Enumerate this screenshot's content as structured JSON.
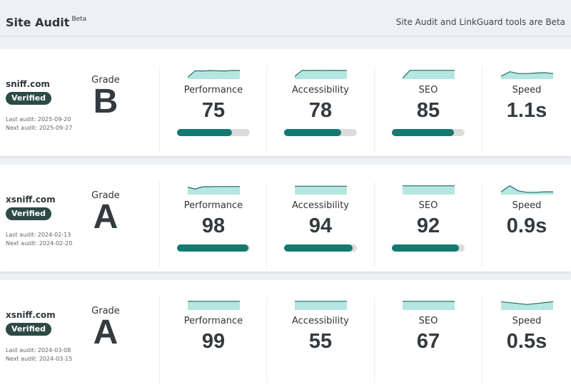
{
  "header": {
    "title": "Site Audit",
    "beta": "Beta",
    "notice": "Site Audit and LinkGuard tools are Beta"
  },
  "colors": {
    "accent": "#137a72",
    "spark_fill": "#b5e6e1",
    "badge": "#2d4a46"
  },
  "sites": [
    {
      "domain": "sniff.com",
      "badge": "Verified",
      "dates": [
        "Last audit: 2025-09-20",
        "Next audit: 2025-09-27"
      ],
      "grade_label": "Grade",
      "grade": "B",
      "metrics": [
        {
          "label": "Performance",
          "value": "75",
          "progress": 75,
          "spark": [
            0.2,
            0.9,
            0.88,
            0.92,
            0.9,
            0.88,
            0.95,
            0.93
          ]
        },
        {
          "label": "Accessibility",
          "value": "78",
          "progress": 78,
          "spark": [
            0.3,
            0.95,
            0.93,
            0.95,
            0.94,
            0.95,
            0.93,
            0.95
          ]
        },
        {
          "label": "SEO",
          "value": "85",
          "progress": 85,
          "spark": [
            0.1,
            0.95,
            0.95,
            0.95,
            0.95,
            0.95,
            0.95,
            0.95
          ]
        },
        {
          "label": "Speed",
          "value": "1.1s",
          "spark": [
            0.3,
            0.8,
            0.6,
            0.6,
            0.65,
            0.7,
            0.6
          ]
        }
      ]
    },
    {
      "domain": "xsniff.com",
      "badge": "Verified",
      "dates": [
        "Last audit: 2024-02-13",
        "Next audit: 2024-02-20"
      ],
      "grade_label": "Grade",
      "grade": "A",
      "metrics": [
        {
          "label": "Performance",
          "value": "98",
          "progress": 98,
          "spark": [
            0.8,
            0.6,
            0.85,
            0.85,
            0.87,
            0.87,
            0.87,
            0.87
          ]
        },
        {
          "label": "Accessibility",
          "value": "94",
          "progress": 94,
          "spark": [
            0.9,
            0.9,
            0.9,
            0.9,
            0.9,
            0.9,
            0.9,
            0.9
          ]
        },
        {
          "label": "SEO",
          "value": "92",
          "progress": 92,
          "spark": [
            0.95,
            0.95,
            0.95,
            0.95,
            0.95,
            0.95,
            0.95,
            0.95
          ]
        },
        {
          "label": "Speed",
          "value": "0.9s",
          "spark": [
            0.3,
            0.95,
            0.4,
            0.25,
            0.25,
            0.3,
            0.3
          ]
        }
      ]
    },
    {
      "domain": "xsniff.com",
      "badge": "Verified",
      "dates": [
        "Last audit: 2024-03-08",
        "Next audit: 2024-03-15"
      ],
      "grade_label": "Grade",
      "grade": "A",
      "metrics": [
        {
          "label": "Performance",
          "value": "99",
          "spark": [
            0.95,
            0.95,
            0.95,
            0.95,
            0.95,
            0.95,
            0.95,
            0.95
          ]
        },
        {
          "label": "Accessibility",
          "value": "55",
          "spark": [
            0.95,
            0.95,
            0.95,
            0.95,
            0.95,
            0.95,
            0.95,
            0.95
          ]
        },
        {
          "label": "SEO",
          "value": "67",
          "spark": [
            0.95,
            0.95,
            0.95,
            0.95,
            0.95,
            0.95,
            0.95,
            0.95
          ]
        },
        {
          "label": "Speed",
          "value": "0.5s",
          "spark": [
            0.9,
            0.75,
            0.6,
            0.75,
            0.9
          ]
        }
      ]
    }
  ]
}
